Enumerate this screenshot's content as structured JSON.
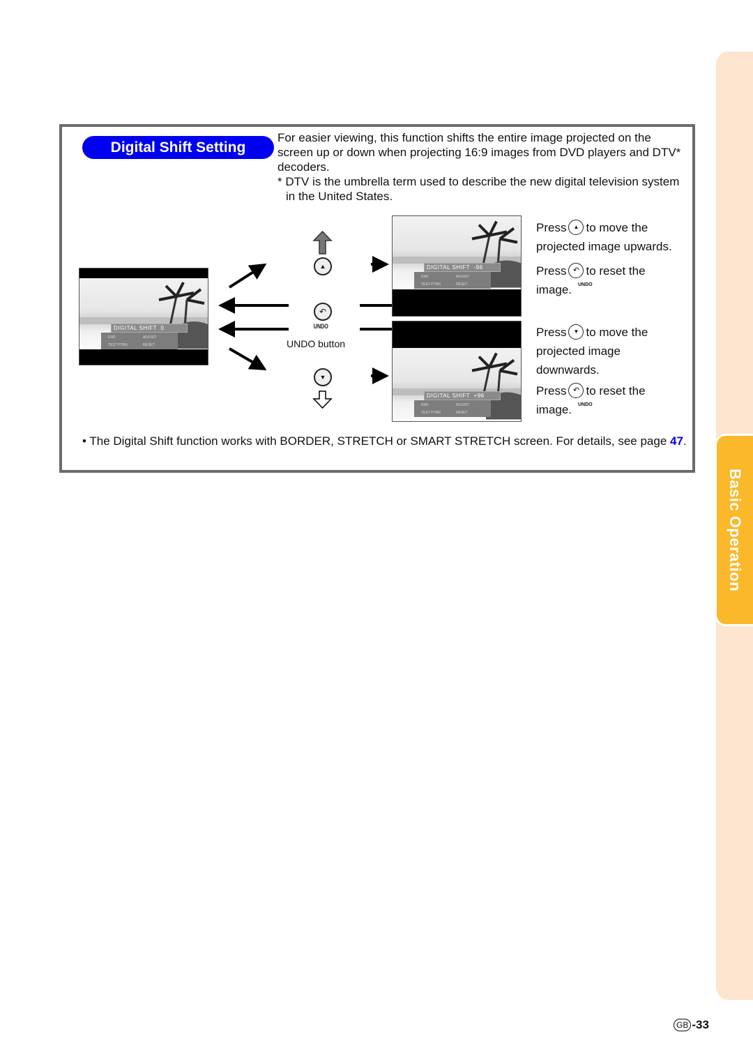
{
  "section": {
    "title": "Digital Shift Setting",
    "intro": "For easier viewing, this function shifts the entire image projected on the screen up or down when projecting 16:9 images from DVD players and DTV* decoders.",
    "footnote": "* DTV is the umbrella term used to describe the new digital television system in the United States."
  },
  "screens": {
    "center": {
      "osd_title": "DIGITAL SHIFT",
      "osd_value": "0",
      "end": "END",
      "adjust": "ADJUST",
      "test": "TEST PTRN",
      "reset": "RESET"
    },
    "upper": {
      "osd_title": "DIGITAL SHIFT",
      "osd_value": "-96",
      "end": "END",
      "adjust": "ADJUST",
      "test": "TEST PTRN",
      "reset": "RESET"
    },
    "lower": {
      "osd_title": "DIGITAL SHIFT",
      "osd_value": "+96",
      "end": "END",
      "adjust": "ADJUST",
      "test": "TEST PTRN",
      "reset": "RESET"
    }
  },
  "buttons": {
    "up_symbol": "▲",
    "down_symbol": "▼",
    "undo_symbol": "↶",
    "undo_label": "UNDO",
    "undo_caption": "UNDO button"
  },
  "instructions": {
    "up": {
      "press": "Press",
      "after": "to move the",
      "line2": "projected image upwards."
    },
    "reset1": {
      "press": "Press",
      "after": "to reset the",
      "line2": "image."
    },
    "down": {
      "press": "Press",
      "after": "to move the",
      "line2": "projected image",
      "line3": "downwards."
    },
    "reset2": {
      "press": "Press",
      "after": "to reset the",
      "line2": "image."
    }
  },
  "note": {
    "bullet": "•",
    "text": "The Digital Shift function works with BORDER, STRETCH or SMART STRETCH screen. For details, see page ",
    "page_link": "47",
    "end": "."
  },
  "side_tab": {
    "label": "Basic Operation"
  },
  "page": {
    "region": "GB",
    "number": "-33"
  },
  "colors": {
    "title_pill": "#0000f0",
    "tab_active": "#fbb82a",
    "tab_bg": "#fde5d0",
    "link": "#0000e0"
  }
}
